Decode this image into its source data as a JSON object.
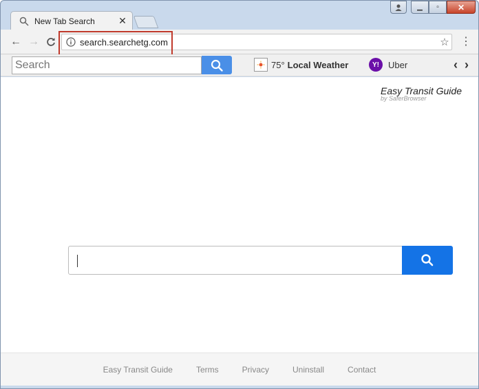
{
  "tab": {
    "title": "New Tab Search"
  },
  "omnibox": {
    "url": "search.searchetg.com"
  },
  "extension_bar": {
    "search_placeholder": "Search",
    "weather_temp": "75°",
    "weather_label": "Local Weather",
    "uber_label": "Uber",
    "yahoo_letter": "Y!"
  },
  "brand": {
    "title": "Easy Transit Guide",
    "subtitle": "by SaferBrowser"
  },
  "footer": {
    "links": [
      "Easy Transit Guide",
      "Terms",
      "Privacy",
      "Uninstall",
      "Contact"
    ]
  },
  "colors": {
    "highlight": "#c0392b",
    "main_search_button": "#1473e6",
    "ext_search_button": "#4a8fe7",
    "yahoo": "#6b0fa8"
  }
}
